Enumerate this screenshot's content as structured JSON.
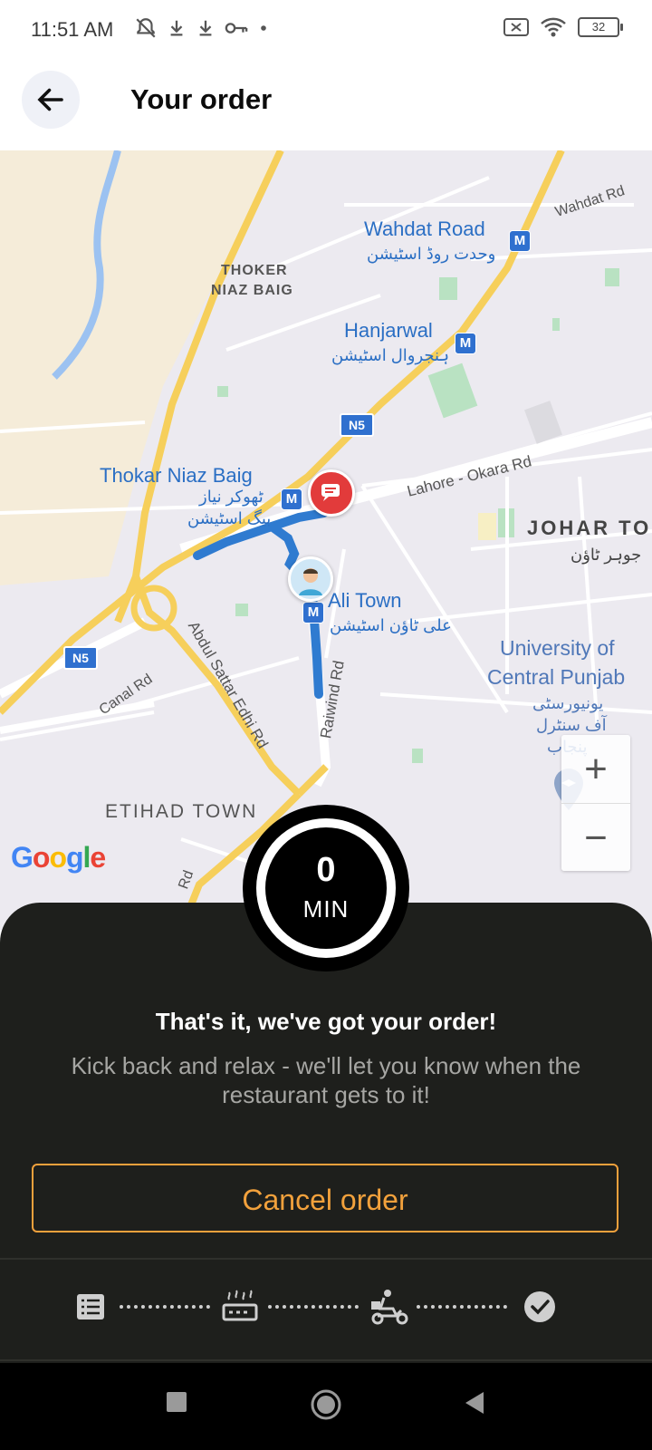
{
  "status_bar": {
    "time": "11:51 AM",
    "battery": "32",
    "icons": [
      "muted-bell-icon",
      "download-icon",
      "download-icon",
      "key-icon",
      "dot-icon",
      "no-sim-icon",
      "wifi-icon",
      "battery-icon"
    ]
  },
  "header": {
    "title": "Your order",
    "back_icon": "arrow-left-icon"
  },
  "map": {
    "labels": {
      "wahdat_road": "Wahdat Road",
      "wahdat_road_urdu": "وحدت روڈ اسٹیشن",
      "wahdat_rd": "Wahdat Rd",
      "thoker": "THOKER",
      "niaz_baig": "NIAZ BAIG",
      "hanjarwal": "Hanjarwal",
      "hanjarwal_urdu": "ہنجروال اسٹیشن",
      "n5_top": "N5",
      "thokar_niaz_baig": "Thokar Niaz Baig",
      "thokar_urdu_1": "ٹھوکر نیاز",
      "thokar_urdu_2": "بیگ اسٹیشن",
      "lahore_okara": "Lahore - Okara Rd",
      "johar": "JOHAR TO",
      "johar_urdu": "جوہر ٹاؤن",
      "ali_town": "Ali Town",
      "ali_town_urdu": "علی ٹاؤن اسٹیشن",
      "university": "University of",
      "central_punjab": "Central Punjab",
      "uni_urdu_1": "یونیورسٹی",
      "uni_urdu_2": "آف سنٹرل",
      "uni_urdu_3": "پنجاب",
      "n5_left": "N5",
      "canal_rd": "Canal Rd",
      "abdul_sattar": "Abdul Sattar Edhi Rd",
      "raiwind_rd": "Raiwind Rd",
      "etihad_town": "ETIHAD TOWN",
      "rd_bottom": "Rd",
      "metro": "M"
    },
    "google": "Google",
    "zoom_in": "+",
    "zoom_out": "−"
  },
  "timer": {
    "value": "0",
    "unit": "MIN"
  },
  "sheet": {
    "title": "That's it, we've got your order!",
    "subtitle": "Kick back and relax - we'll let you know when the restaurant gets to it!",
    "cancel_label": "Cancel order",
    "steps": [
      "order-list-icon",
      "restaurant-cooking-icon",
      "delivery-rider-icon",
      "check-circle-icon"
    ]
  },
  "colors": {
    "accent": "#f2a13c",
    "sheet_bg": "#1e1f1c",
    "route": "#2f7bd0",
    "map_road": "#f6cf5b"
  }
}
